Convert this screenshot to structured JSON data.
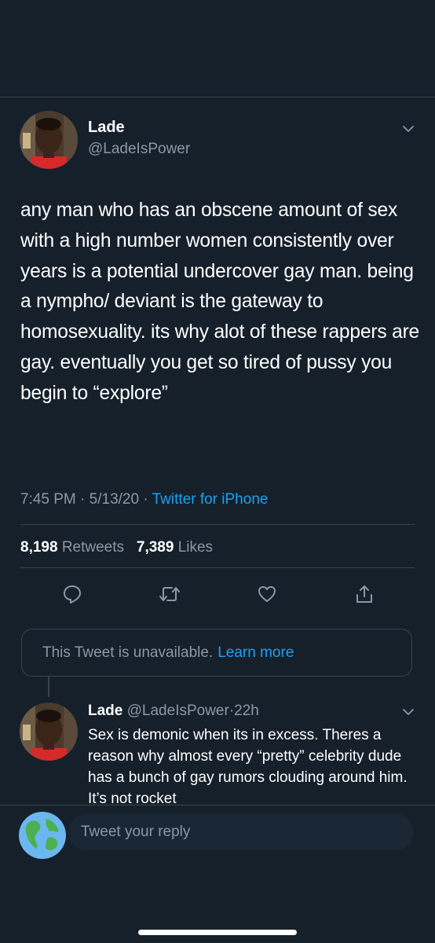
{
  "tweet": {
    "author_name": "Lade",
    "author_handle": "@LadeIsPower",
    "text": "any man who has an obscene amount of sex with a high number women consistently over years is a potential undercover gay man. being a nympho/ deviant is the gateway to homosexuality. its why alot of these rappers are gay. eventually you get so tired of pussy you begin to “explore”",
    "time": "7:45 PM",
    "date": "5/13/20",
    "source": "Twitter for iPhone",
    "retweets_count": "8,198",
    "retweets_label": "Retweets",
    "likes_count": "7,389",
    "likes_label": "Likes"
  },
  "actions": {
    "reply_icon": "comment-icon",
    "retweet_icon": "retweet-icon",
    "like_icon": "heart-icon",
    "share_icon": "share-icon"
  },
  "unavailable": {
    "text": "This Tweet is unavailable.",
    "link": "Learn more"
  },
  "reply_tweet": {
    "author_name": "Lade",
    "author_handle": "@LadeIsPower",
    "separator": "·",
    "time_ago": "22h",
    "text": "Sex is demonic when its in excess. Theres a reason why almost every “pretty” celebrity dude has a bunch of gay rumors clouding around him. It’s not rocket"
  },
  "reply_bar": {
    "placeholder": "Tweet your reply"
  },
  "colors": {
    "background": "#15202b",
    "secondary_text": "#8899a6",
    "accent": "#1da1f2",
    "divider": "#38444d"
  }
}
